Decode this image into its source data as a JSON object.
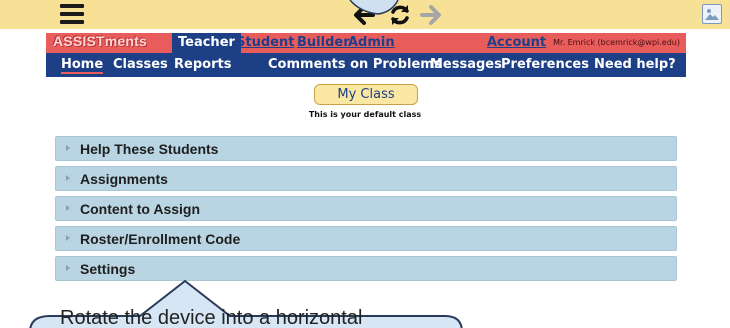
{
  "toolbar": {
    "icons": [
      "menu-icon",
      "back-arrow-icon",
      "refresh-icon",
      "forward-arrow-icon",
      "broken-image-icon"
    ]
  },
  "header": {
    "logo": "ASSISTments",
    "active_role": "Teacher",
    "role_links": [
      "Student",
      "Builder",
      "Admin"
    ],
    "account_link": "Account",
    "user": "Mr. Emrick (bcemrick@wpi.edu)"
  },
  "nav": {
    "items": [
      "Home",
      "Classes",
      "Reports",
      "Comments on Problems",
      "Messages",
      "Preferences",
      "Need help?"
    ],
    "active": "Home"
  },
  "main": {
    "title": "My Class",
    "subtitle": "This is your default class",
    "sections": [
      "Help These Students",
      "Assignments",
      "Content to Assign",
      "Roster/Enrollment Code",
      "Settings"
    ]
  },
  "tooltip": {
    "text": "Rotate the device into a horizontal"
  },
  "colors": {
    "toolbar_bg": "#f7e196",
    "header_red": "#e85c5c",
    "nav_blue": "#1c3f86",
    "section_bg": "#b9d5e3",
    "title_bg": "#fbe7a4"
  }
}
